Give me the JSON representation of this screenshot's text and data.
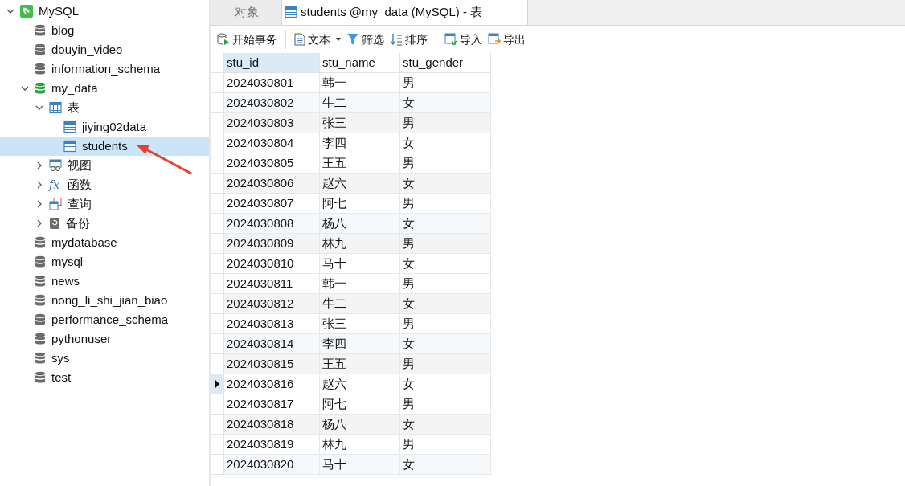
{
  "tree": [
    {
      "kind": "connection",
      "label": "MySQL",
      "expanded": true,
      "children": [
        {
          "kind": "database",
          "label": "blog",
          "open": false
        },
        {
          "kind": "database",
          "label": "douyin_video",
          "open": false
        },
        {
          "kind": "database",
          "label": "information_schema",
          "open": false
        },
        {
          "kind": "database",
          "label": "my_data",
          "open": true,
          "expanded": true,
          "children": [
            {
              "kind": "tables",
              "label": "表",
              "expanded": true,
              "children": [
                {
                  "kind": "table",
                  "label": "jiying02data",
                  "selected": false
                },
                {
                  "kind": "table",
                  "label": "students",
                  "selected": true
                }
              ]
            },
            {
              "kind": "views",
              "label": "视图",
              "expanded": false
            },
            {
              "kind": "functions",
              "label": "函数",
              "icon": "fx",
              "expanded": false
            },
            {
              "kind": "queries",
              "label": "查询",
              "expanded": false
            },
            {
              "kind": "backups",
              "label": "备份",
              "expanded": false
            }
          ]
        },
        {
          "kind": "database",
          "label": "mydatabase",
          "open": false
        },
        {
          "kind": "database",
          "label": "mysql",
          "open": false
        },
        {
          "kind": "database",
          "label": "news",
          "open": false
        },
        {
          "kind": "database",
          "label": "nong_li_shi_jian_biao",
          "open": false
        },
        {
          "kind": "database",
          "label": "performance_schema",
          "open": false
        },
        {
          "kind": "database",
          "label": "pythonuser",
          "open": false
        },
        {
          "kind": "database",
          "label": "sys",
          "open": false
        },
        {
          "kind": "database",
          "label": "test",
          "open": false
        }
      ]
    }
  ],
  "tabs": [
    {
      "label": "对象",
      "selected": false,
      "kind": "plain"
    },
    {
      "label": "students @my_data (MySQL) - 表",
      "selected": true,
      "kind": "table"
    }
  ],
  "toolbar": [
    {
      "kind": "transaction",
      "label": "开始事务"
    },
    {
      "kind": "separator"
    },
    {
      "kind": "text",
      "label": "文本",
      "dropdown": true
    },
    {
      "kind": "filter",
      "label": "筛选"
    },
    {
      "kind": "sort",
      "label": "排序"
    },
    {
      "kind": "separator"
    },
    {
      "kind": "import",
      "label": "导入"
    },
    {
      "kind": "export",
      "label": "导出"
    }
  ],
  "table": {
    "columns": [
      {
        "label": "stu_id",
        "selected": true
      },
      {
        "label": "stu_name",
        "selected": false
      },
      {
        "label": "stu_gender",
        "selected": false
      }
    ],
    "rows": [
      {
        "cells": [
          "2024030801",
          "韩一",
          "男"
        ],
        "current": false
      },
      {
        "cells": [
          "2024030802",
          "牛二",
          "女"
        ],
        "current": false
      },
      {
        "cells": [
          "2024030803",
          "张三",
          "男"
        ],
        "current": false
      },
      {
        "cells": [
          "2024030804",
          "李四",
          "女"
        ],
        "current": false
      },
      {
        "cells": [
          "2024030805",
          "王五",
          "男"
        ],
        "current": false
      },
      {
        "cells": [
          "2024030806",
          "赵六",
          "女"
        ],
        "current": false
      },
      {
        "cells": [
          "2024030807",
          "阿七",
          "男"
        ],
        "current": false
      },
      {
        "cells": [
          "2024030808",
          "杨八",
          "女"
        ],
        "current": false
      },
      {
        "cells": [
          "2024030809",
          "林九",
          "男"
        ],
        "current": false
      },
      {
        "cells": [
          "2024030810",
          "马十",
          "女"
        ],
        "current": false
      },
      {
        "cells": [
          "2024030811",
          "韩一",
          "男"
        ],
        "current": false
      },
      {
        "cells": [
          "2024030812",
          "牛二",
          "女"
        ],
        "current": false
      },
      {
        "cells": [
          "2024030813",
          "张三",
          "男"
        ],
        "current": false
      },
      {
        "cells": [
          "2024030814",
          "李四",
          "女"
        ],
        "current": false
      },
      {
        "cells": [
          "2024030815",
          "王五",
          "男"
        ],
        "current": false
      },
      {
        "cells": [
          "2024030816",
          "赵六",
          "女"
        ],
        "current": true
      },
      {
        "cells": [
          "2024030817",
          "阿七",
          "男"
        ],
        "current": false
      },
      {
        "cells": [
          "2024030818",
          "杨八",
          "女"
        ],
        "current": false
      },
      {
        "cells": [
          "2024030819",
          "林九",
          "男"
        ],
        "current": false
      },
      {
        "cells": [
          "2024030820",
          "马十",
          "女"
        ],
        "current": false
      }
    ]
  }
}
